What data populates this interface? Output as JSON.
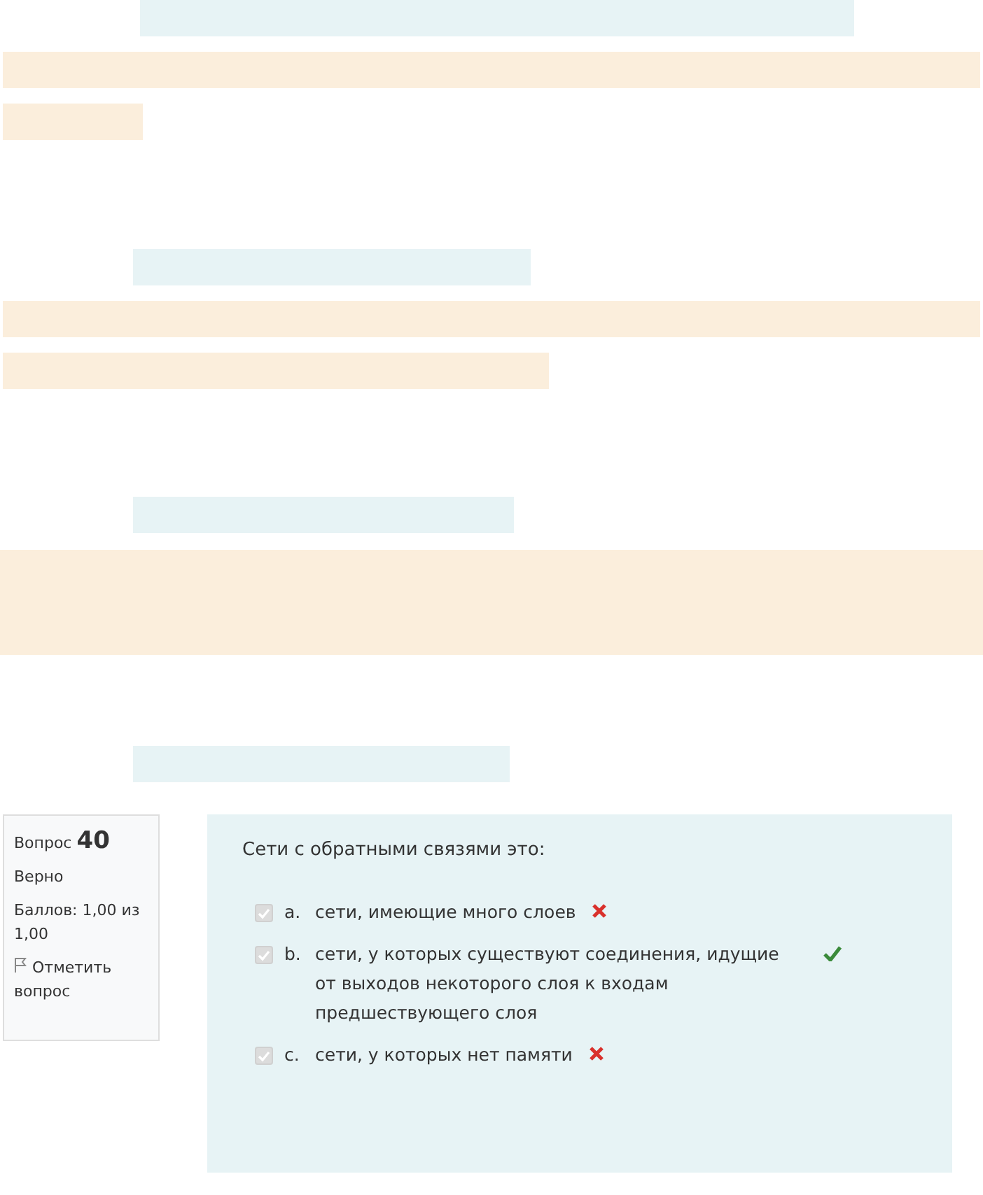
{
  "question_info": {
    "label": "Вопрос",
    "number": "40",
    "status": "Верно",
    "score": "Баллов: 1,00 из 1,00",
    "flag": "Отметить вопрос"
  },
  "question": {
    "text": "Сети с обратными связями это:",
    "answers": [
      {
        "letter": "a.",
        "text": "сети, имеющие много слоев",
        "checked": true,
        "kind": "wrong"
      },
      {
        "letter": "b.",
        "text": "сети, у которых существуют соединения, идущие от выходов некоторого слоя к входам предшествующего слоя",
        "checked": true,
        "kind": "right"
      },
      {
        "letter": "c.",
        "text": "сети, у которых нет памяти",
        "checked": true,
        "kind": "wrong"
      }
    ]
  }
}
